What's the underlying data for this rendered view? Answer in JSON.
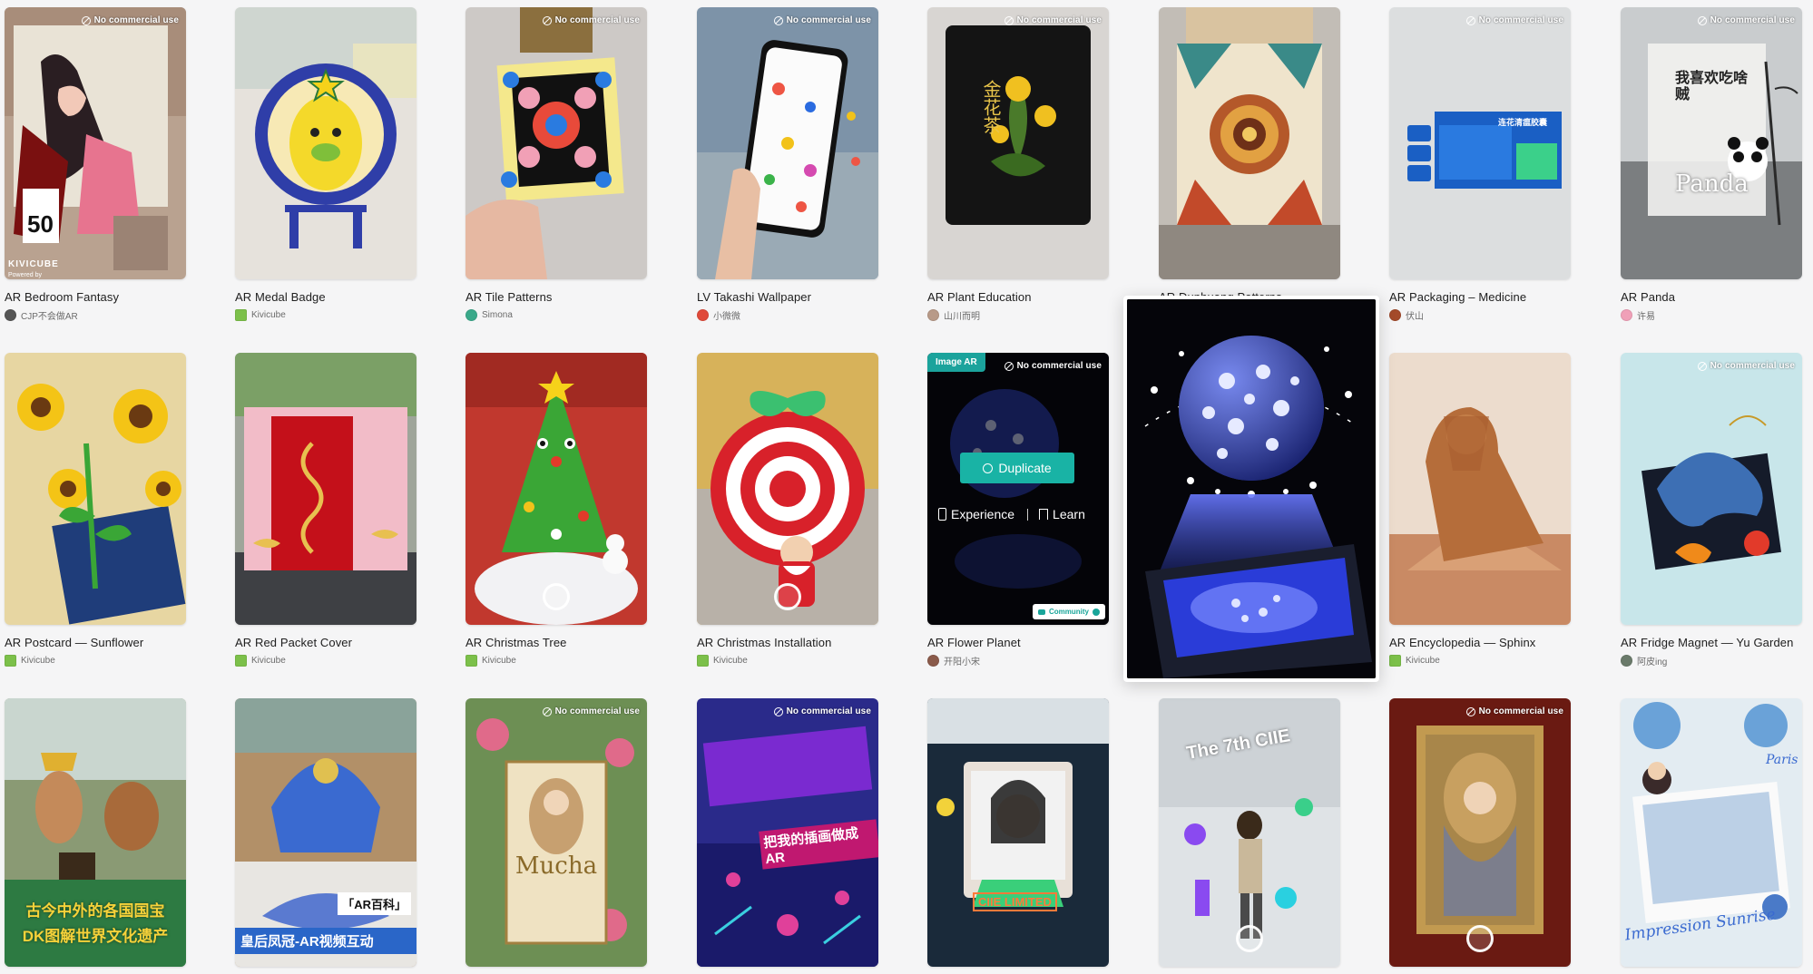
{
  "no_commercial_label": "No commercial use",
  "rows": [
    [
      {
        "title": "AR Bedroom Fantasy",
        "author": "CJP不会做AR",
        "nc": true
      },
      {
        "title": "AR Medal Badge",
        "author": "Kivicube",
        "nc": false
      },
      {
        "title": "AR Tile Patterns",
        "author": "Simona",
        "nc": true
      },
      {
        "title": "LV Takashi Wallpaper",
        "author": "小微微",
        "nc": true
      },
      {
        "title": "AR Plant Education",
        "author": "山川而明",
        "nc": true
      },
      {
        "title": "AR Dunhuang Patterns",
        "author": "",
        "nc": false
      },
      {
        "title": "AR Packaging – Medicine",
        "author": "伏山",
        "nc": true
      },
      {
        "title": "AR Panda",
        "author": "许易",
        "nc": true
      }
    ],
    [
      {
        "title": "AR Postcard — Sunflower",
        "author": "Kivicube",
        "nc": false
      },
      {
        "title": "AR Red Packet Cover",
        "author": "Kivicube",
        "nc": false
      },
      {
        "title": "AR Christmas Tree",
        "author": "Kivicube",
        "nc": false
      },
      {
        "title": "AR Christmas Installation",
        "author": "Kivicube",
        "nc": false
      },
      {
        "title": "AR Flower Planet",
        "author": "开阳小宋",
        "nc": true
      },
      {
        "title": "",
        "author": "",
        "nc": false
      },
      {
        "title": "AR Encyclopedia — Sphinx",
        "author": "Kivicube",
        "nc": false
      },
      {
        "title": "AR Fridge Magnet — Yu Garden",
        "author": "阿皮ing",
        "nc": true
      }
    ],
    [
      {
        "title": "",
        "author": "",
        "nc": false
      },
      {
        "title": "",
        "author": "",
        "nc": false
      },
      {
        "title": "",
        "author": "",
        "nc": true
      },
      {
        "title": "",
        "author": "",
        "nc": true
      },
      {
        "title": "",
        "author": "",
        "nc": false
      },
      {
        "title": "",
        "author": "",
        "nc": false
      },
      {
        "title": "",
        "author": "",
        "nc": true
      },
      {
        "title": "",
        "author": "",
        "nc": false
      }
    ]
  ],
  "overlay": {
    "tag": "Image AR",
    "duplicate_label": "Duplicate",
    "experience_label": "Experience",
    "learn_label": "Learn",
    "community_label": "Community"
  },
  "thumb_text": {
    "kivicube_brand": "KIVICUBE",
    "powered_by": "Powered by",
    "jinhuacha": "金花茶",
    "packaging_cn": "连花清瘟胶囊",
    "panda_cn": "我喜欢吃啥贼",
    "panda_word": "Panda",
    "ar_baike": "「AR百科」",
    "queen_crown": "皇后凤冠-AR视频互动",
    "dk_cn_1": "古今中外的各国国宝",
    "dk_cn_2": "DK图解世界文化遗产",
    "mucha": "Mucha",
    "illus_cn": "把我的插画做成AR",
    "ciie_limited": "CIIE LIMITED",
    "the7th": "The 7th CIIE",
    "impression": "Impression Sunrise",
    "paris": "Paris"
  },
  "colors": {
    "accent": "#19b3a5",
    "page_bg": "#f5f5f6"
  }
}
